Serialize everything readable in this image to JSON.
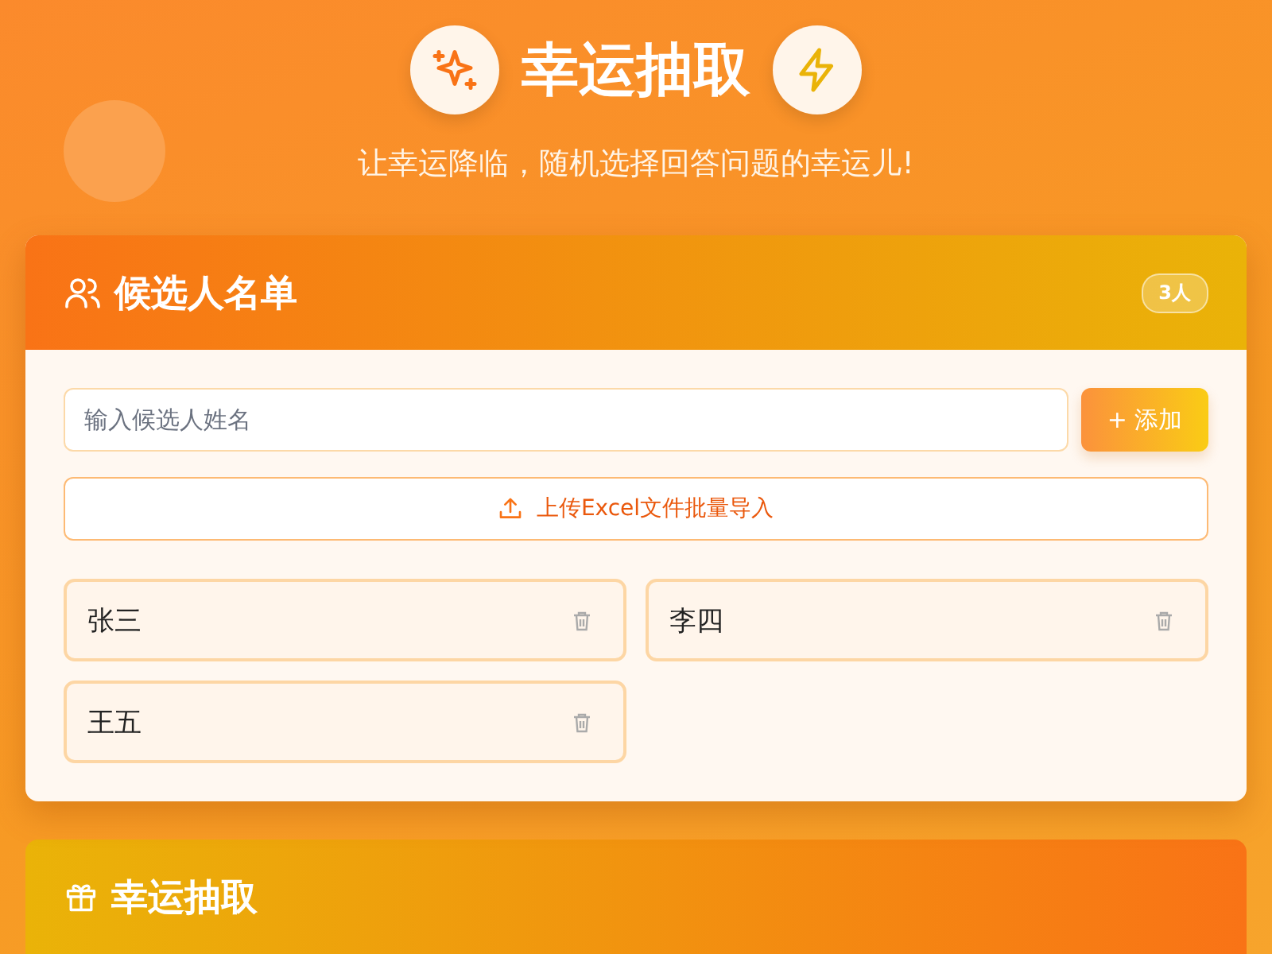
{
  "header": {
    "title": "幸运抽取",
    "subtitle": "让幸运降临，随机选择回答问题的幸运儿!"
  },
  "candidates": {
    "title": "候选人名单",
    "count": "3人",
    "input": {
      "placeholder": "输入候选人姓名"
    },
    "add_button": "+ 添加",
    "upload_button": "上传Excel文件批量导入",
    "names": [
      "张三",
      "李四",
      "王五"
    ]
  },
  "draw": {
    "title": "幸运抽取"
  }
}
